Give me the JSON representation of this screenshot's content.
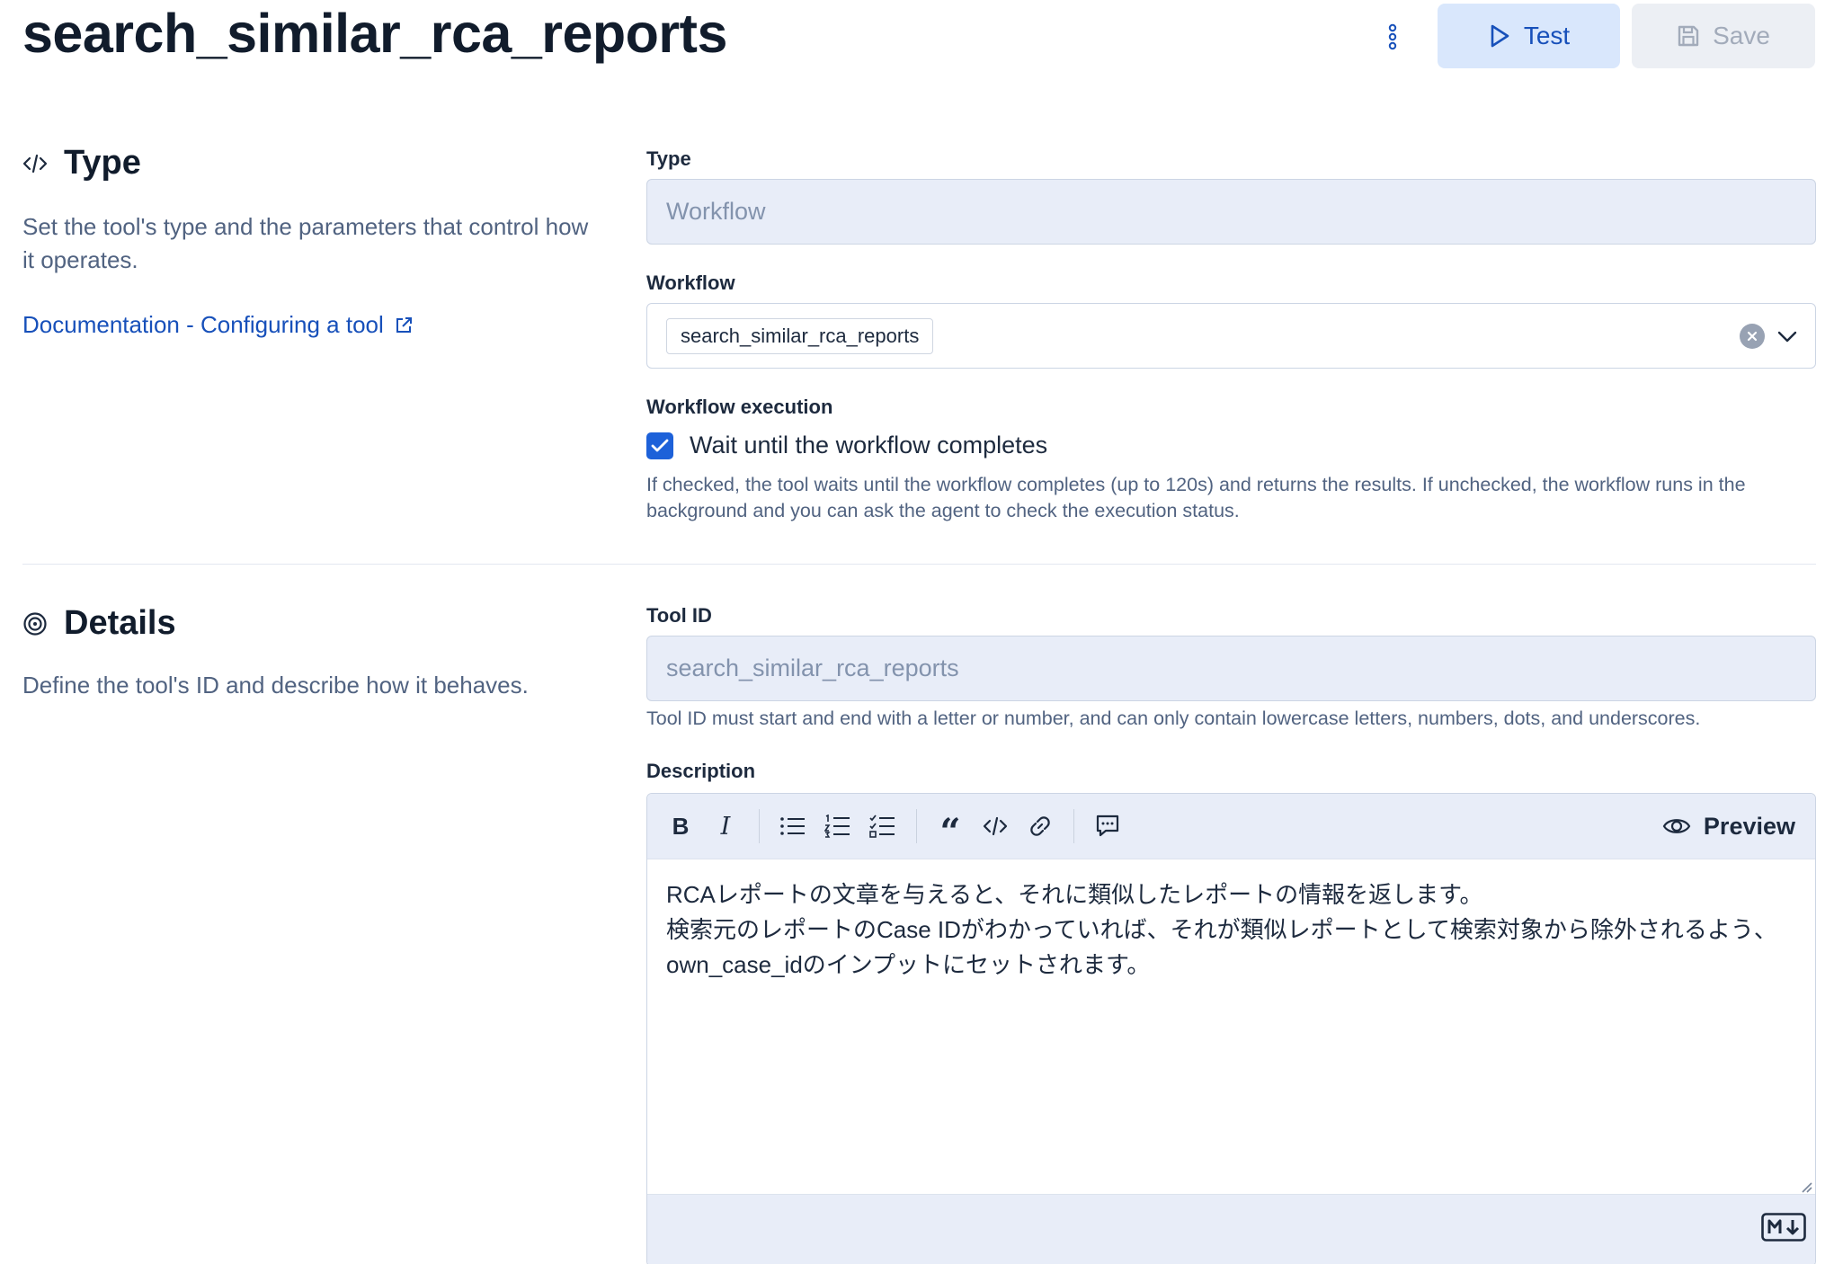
{
  "header": {
    "title": "search_similar_rca_reports",
    "test_label": "Test",
    "save_label": "Save"
  },
  "type_section": {
    "heading": "Type",
    "description": "Set the tool's type and the parameters that control how it operates.",
    "doc_link": "Documentation - Configuring a tool",
    "type_label": "Type",
    "type_value": "Workflow",
    "workflow_label": "Workflow",
    "workflow_selected": "search_similar_rca_reports",
    "execution_label": "Workflow execution",
    "wait_checkbox_label": "Wait until the workflow completes",
    "wait_checked": true,
    "execution_help": "If checked, the tool waits until the workflow completes (up to 120s) and returns the results. If unchecked, the workflow runs in the background and you can ask the agent to check the execution status."
  },
  "details_section": {
    "heading": "Details",
    "description": "Define the tool's ID and describe how it behaves.",
    "tool_id_label": "Tool ID",
    "tool_id_value": "search_similar_rca_reports",
    "tool_id_help": "Tool ID must start and end with a letter or number, and can only contain lowercase letters, numbers, dots, and underscores.",
    "description_label": "Description",
    "preview_label": "Preview",
    "description_lines": [
      "RCAレポートの文章を与えると、それに類似したレポートの情報を返します。",
      "検索元のレポートのCase IDがわかっていれば、それが類似レポートとして検索対象から除外されるよう、",
      "own_case_idのインプットにセットされます。"
    ]
  },
  "colors": {
    "accent": "#1d61d9",
    "link": "#1750ba",
    "test_button_bg": "#d9e7fc",
    "disabled_field_bg": "#e8edf8"
  }
}
